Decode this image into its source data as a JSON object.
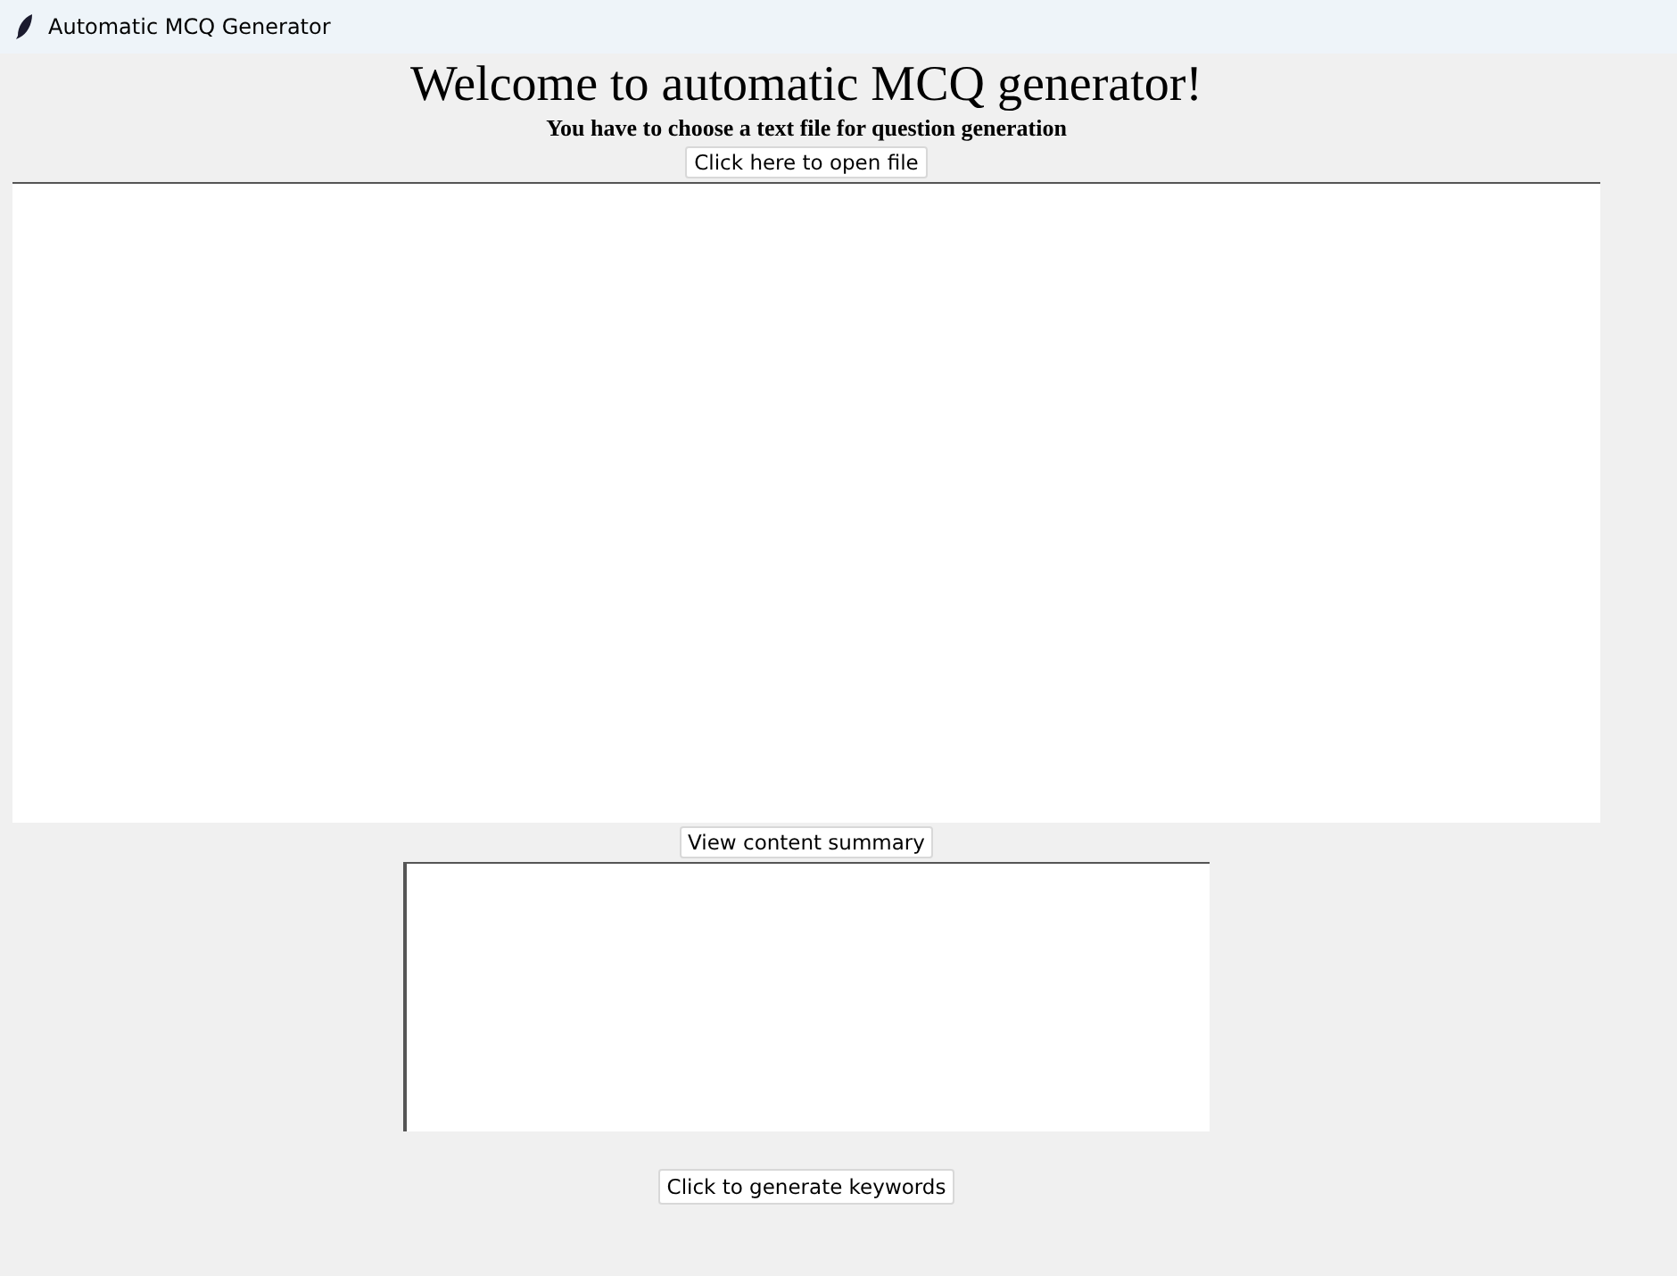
{
  "window": {
    "title": "Automatic MCQ Generator"
  },
  "heading": "Welcome to automatic MCQ generator!",
  "instruction": "You have to choose a text file for question generation",
  "open_button": "Click here to open file",
  "summary_button": "View content summary",
  "keywords_button": "Click to generate keywords"
}
